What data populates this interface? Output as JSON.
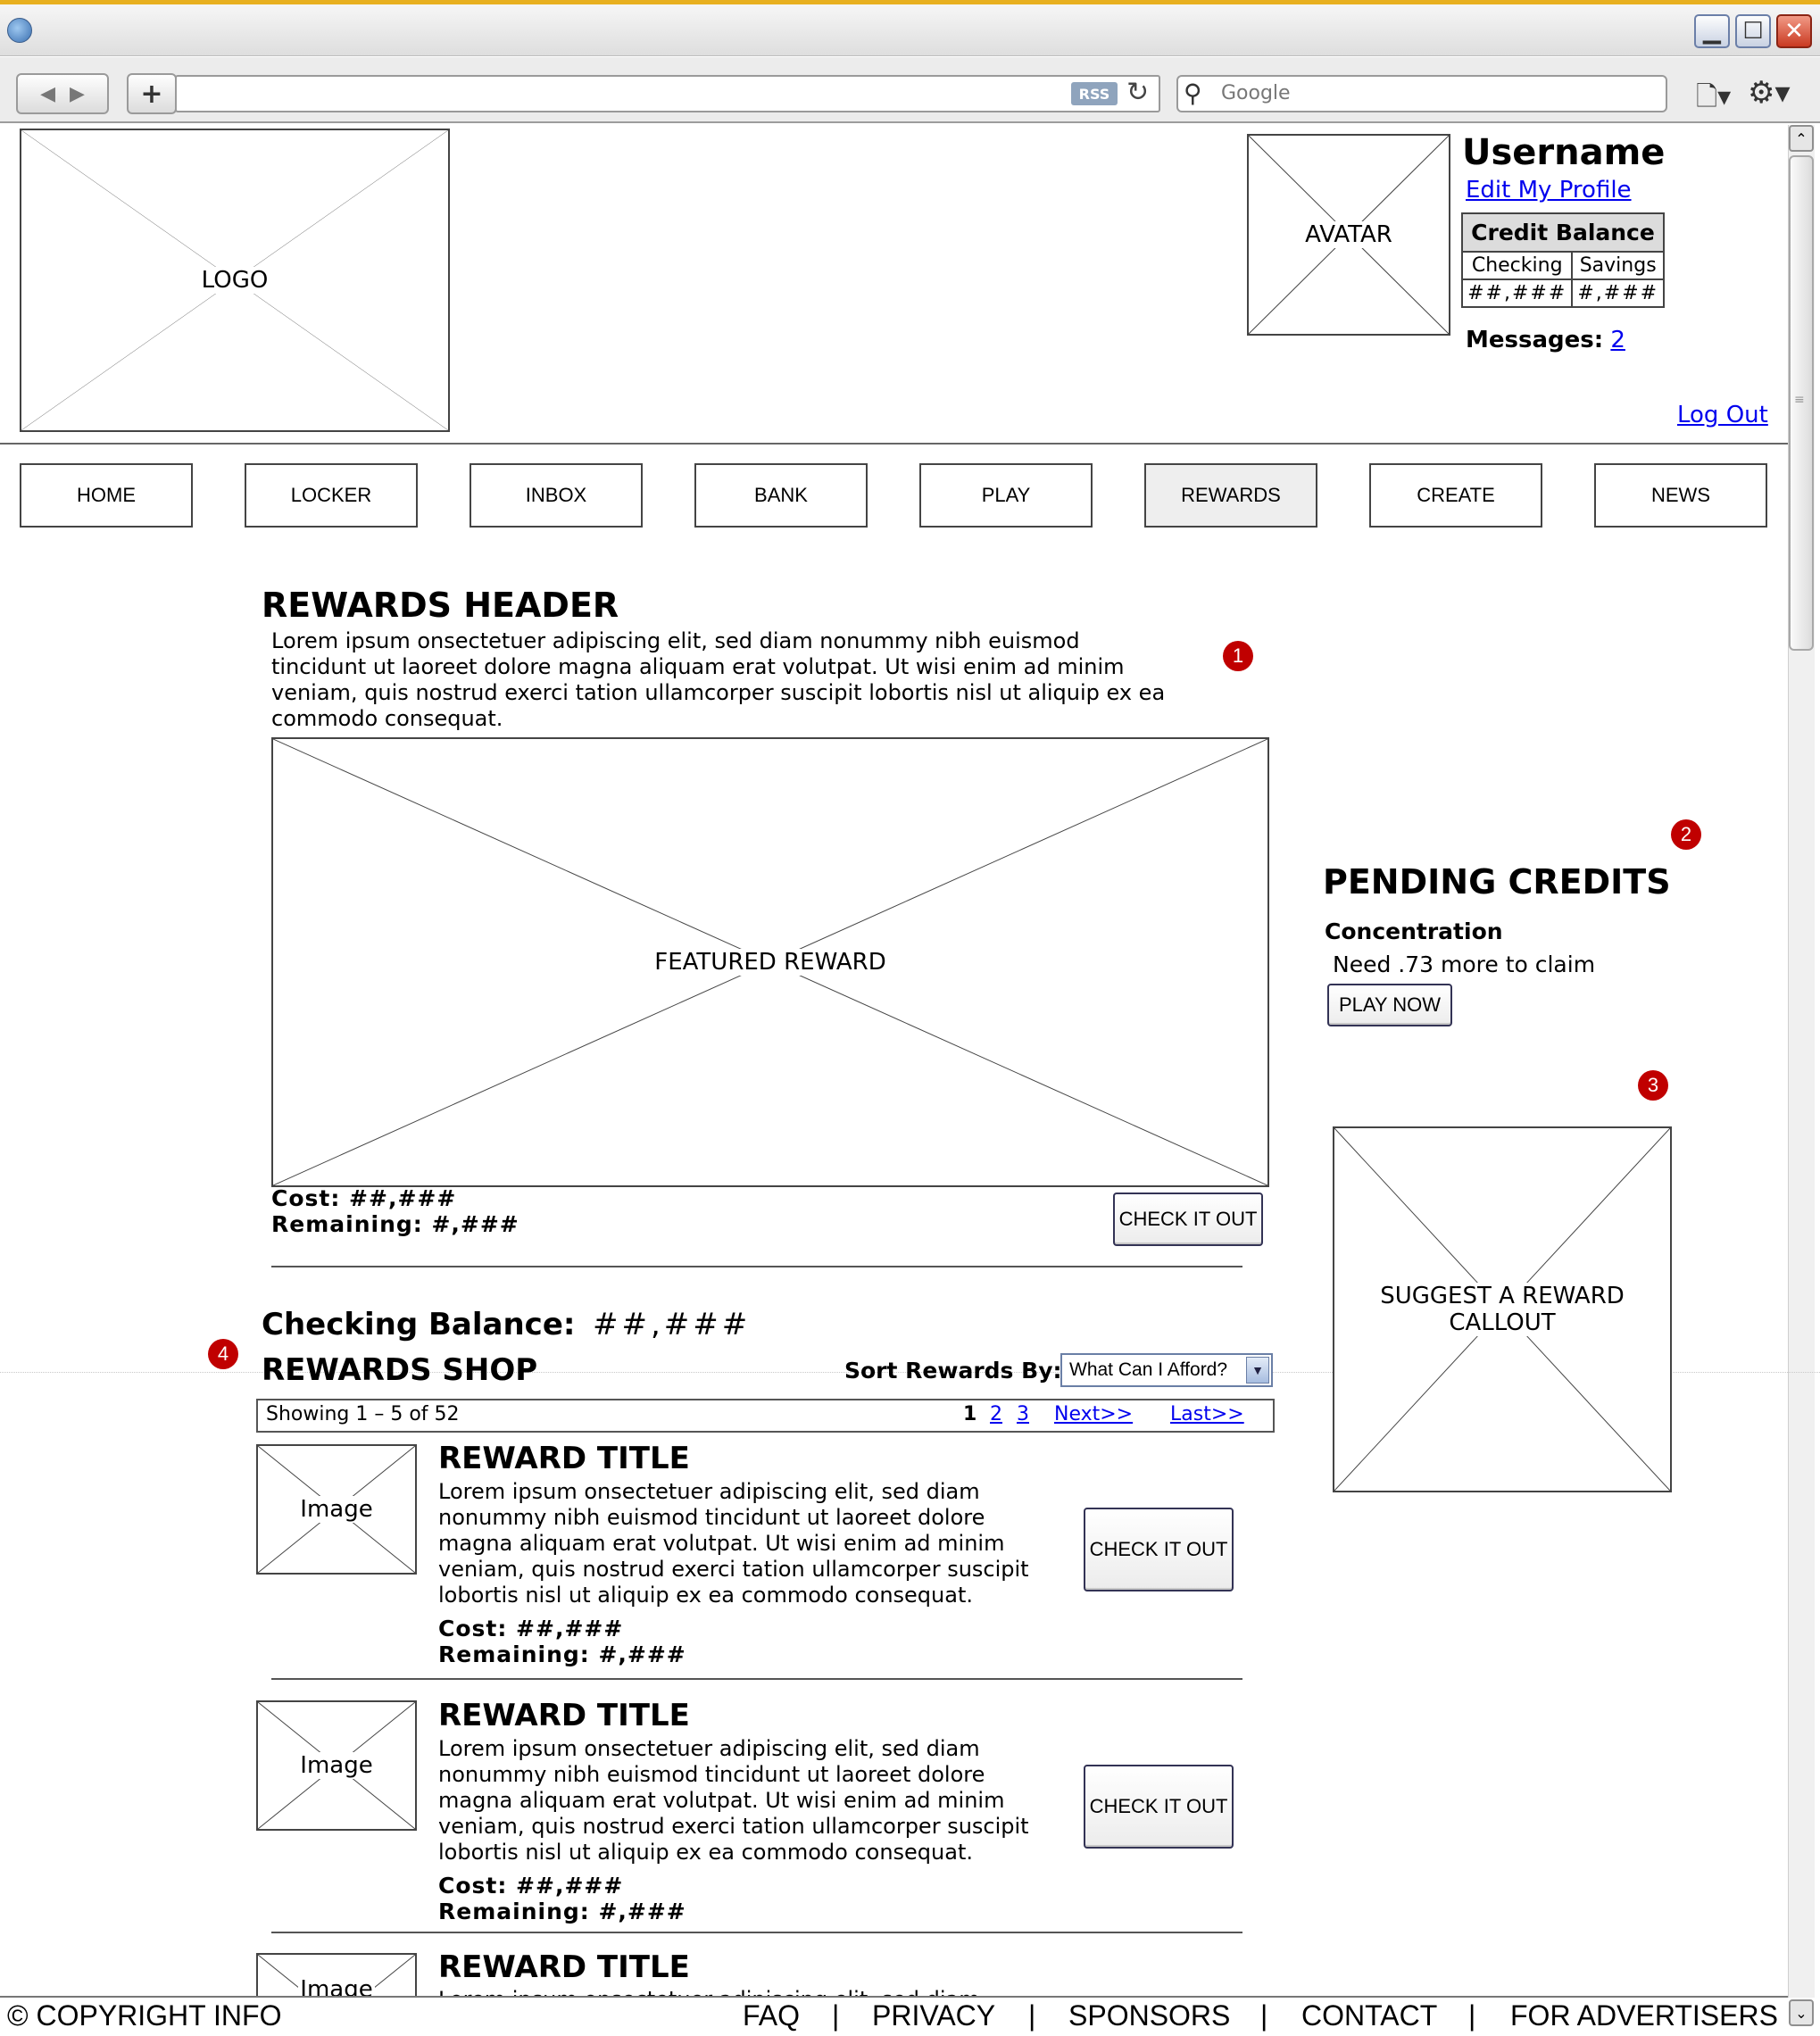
{
  "browser": {
    "address_value": "",
    "rss_label": "RSS",
    "search_placeholder": "Google"
  },
  "header": {
    "logo_label": "LOGO",
    "avatar_label": "AVATAR",
    "username": "Username",
    "edit_profile": "Edit My Profile",
    "credit_balance": {
      "title": "Credit Balance",
      "columns": [
        "Checking",
        "Savings"
      ],
      "values": [
        "##,###",
        "#,###"
      ]
    },
    "messages_label": "Messages:",
    "messages_count": "2",
    "logout": "Log Out"
  },
  "nav": {
    "items": [
      "HOME",
      "LOCKER",
      "INBOX",
      "BANK",
      "PLAY",
      "REWARDS",
      "CREATE",
      "NEWS"
    ],
    "active": "REWARDS"
  },
  "annotations": [
    "1",
    "2",
    "3",
    "4"
  ],
  "rewards": {
    "header": "REWARDS HEADER",
    "intro": "Lorem ipsum onsectetuer adipiscing elit, sed diam nonummy nibh euismod tincidunt ut laoreet dolore magna aliquam erat volutpat. Ut wisi enim ad minim veniam, quis nostrud exerci tation ullamcorper suscipit lobortis nisl ut aliquip ex ea commodo consequat.",
    "featured_label": "FEATURED REWARD",
    "featured_cost": "Cost: ##,###",
    "featured_remaining": "Remaining: #,###",
    "check_it_out": "CHECK IT OUT",
    "checking_balance_label": "Checking Balance:",
    "checking_balance_value": "##,###"
  },
  "shop": {
    "title": "REWARDS SHOP",
    "sort_label": "Sort Rewards By:",
    "sort_value": "What Can I Afford?",
    "showing": "Showing 1 – 5 of 52",
    "pages": [
      "1",
      "2",
      "3"
    ],
    "next": "Next>>",
    "last": "Last>>",
    "items": [
      {
        "image_label": "Image",
        "title": "REWARD TITLE",
        "description": "Lorem ipsum onsectetuer adipiscing elit, sed diam nonummy nibh euismod tincidunt ut laoreet dolore magna aliquam erat volutpat. Ut wisi enim ad minim veniam, quis nostrud exerci tation ullamcorper suscipit lobortis nisl ut aliquip ex ea commodo consequat.",
        "cost": "Cost: ##,###",
        "remaining": "Remaining: #,###",
        "button": "CHECK IT OUT"
      },
      {
        "image_label": "Image",
        "title": "REWARD TITLE",
        "description": "Lorem ipsum onsectetuer adipiscing elit, sed diam nonummy nibh euismod tincidunt ut laoreet dolore magna aliquam erat volutpat. Ut wisi enim ad minim veniam, quis nostrud exerci tation ullamcorper suscipit lobortis nisl ut aliquip ex ea commodo consequat.",
        "cost": "Cost: ##,###",
        "remaining": "Remaining: #,###",
        "button": "CHECK IT OUT"
      },
      {
        "image_label": "Image",
        "title": "REWARD TITLE",
        "description": "Lorem ipsum onsectetuer adipiscing elit, sed diam"
      }
    ]
  },
  "pending": {
    "title": "PENDING CREDITS",
    "item_name": "Concentration",
    "item_need": "Need .73 more to claim",
    "play_now": "PLAY NOW"
  },
  "suggest": {
    "label_line1": "SUGGEST A REWARD",
    "label_line2": "CALLOUT"
  },
  "footer": {
    "copyright": "© COPYRIGHT INFO",
    "links": [
      "FAQ",
      "PRIVACY",
      "SPONSORS",
      "CONTACT",
      "FOR ADVERTISERS"
    ],
    "separator": "|"
  }
}
